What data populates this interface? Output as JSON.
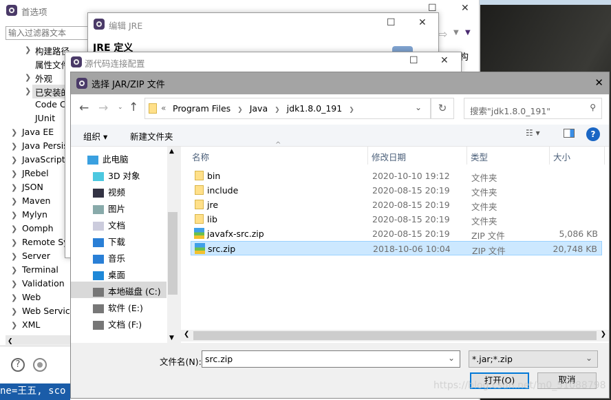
{
  "prefs": {
    "title": "首选项",
    "filter_placeholder": "输入过滤器文本",
    "sub_items": [
      {
        "label": "构建路径",
        "chevron": true
      },
      {
        "label": "属性文件",
        "chevron": false
      },
      {
        "label": "外观",
        "chevron": true
      },
      {
        "label": "已安装的",
        "chevron": true,
        "selected": true
      },
      {
        "label": "Code C",
        "chevron": false
      },
      {
        "label": "JUnit",
        "chevron": false
      }
    ],
    "top_items": [
      "Java EE",
      "Java Persis",
      "JavaScript",
      "JRebel",
      "JSON",
      "Maven",
      "Mylyn",
      "Oomph",
      "Remote Sy",
      "Server",
      "Terminal",
      "Validation",
      "Web",
      "Web Service",
      "XML"
    ],
    "right_fragment": "构",
    "console_text": "ne=王五, sco"
  },
  "edit_jre": {
    "title": "编辑 JRE",
    "heading": "JRE 定义"
  },
  "source_dialog": {
    "title": "源代码连接配置"
  },
  "chooser": {
    "title": "选择 JAR/ZIP 文件",
    "breadcrumb": [
      "Program Files",
      "Java",
      "jdk1.8.0_191"
    ],
    "search_placeholder": "搜索\"jdk1.8.0_191\"",
    "toolbar": {
      "organize": "组织",
      "new_folder": "新建文件夹"
    },
    "nav": [
      {
        "label": "此电脑",
        "icon": "computer-icon",
        "color": "#3aa0e0"
      },
      {
        "label": "3D 对象",
        "icon": "cube-icon",
        "color": "#4cc8e0"
      },
      {
        "label": "视频",
        "icon": "film-icon",
        "color": "#334"
      },
      {
        "label": "图片",
        "icon": "picture-icon",
        "color": "#8aa"
      },
      {
        "label": "文档",
        "icon": "document-icon",
        "color": "#ccd"
      },
      {
        "label": "下载",
        "icon": "download-icon",
        "color": "#2a7fd6"
      },
      {
        "label": "音乐",
        "icon": "music-icon",
        "color": "#2a7fd6"
      },
      {
        "label": "桌面",
        "icon": "desktop-icon",
        "color": "#1e88d8"
      },
      {
        "label": "本地磁盘 (C:)",
        "icon": "drive-icon",
        "color": "#777",
        "selected": true
      },
      {
        "label": "软件 (E:)",
        "icon": "drive-icon",
        "color": "#777"
      },
      {
        "label": "文档 (F:)",
        "icon": "drive-icon",
        "color": "#777"
      }
    ],
    "columns": [
      "名称",
      "修改日期",
      "类型",
      "大小"
    ],
    "files": [
      {
        "name": "bin",
        "date": "2020-10-10 19:12",
        "type": "文件夹",
        "size": "",
        "kind": "folder"
      },
      {
        "name": "include",
        "date": "2020-08-15 20:19",
        "type": "文件夹",
        "size": "",
        "kind": "folder"
      },
      {
        "name": "jre",
        "date": "2020-08-15 20:19",
        "type": "文件夹",
        "size": "",
        "kind": "folder"
      },
      {
        "name": "lib",
        "date": "2020-08-15 20:19",
        "type": "文件夹",
        "size": "",
        "kind": "folder"
      },
      {
        "name": "javafx-src.zip",
        "date": "2020-08-15 20:19",
        "type": "ZIP 文件",
        "size": "5,086 KB",
        "kind": "zip"
      },
      {
        "name": "src.zip",
        "date": "2018-10-06 10:04",
        "type": "ZIP 文件",
        "size": "20,748 KB",
        "kind": "zip",
        "selected": true
      }
    ],
    "filename_label": "文件名(N):",
    "filename_value": "src.zip",
    "filter_value": "*.jar;*.zip",
    "open": "打开(O)",
    "cancel": "取消"
  },
  "watermark": "https://blog.csdn.net/m0_51088798"
}
